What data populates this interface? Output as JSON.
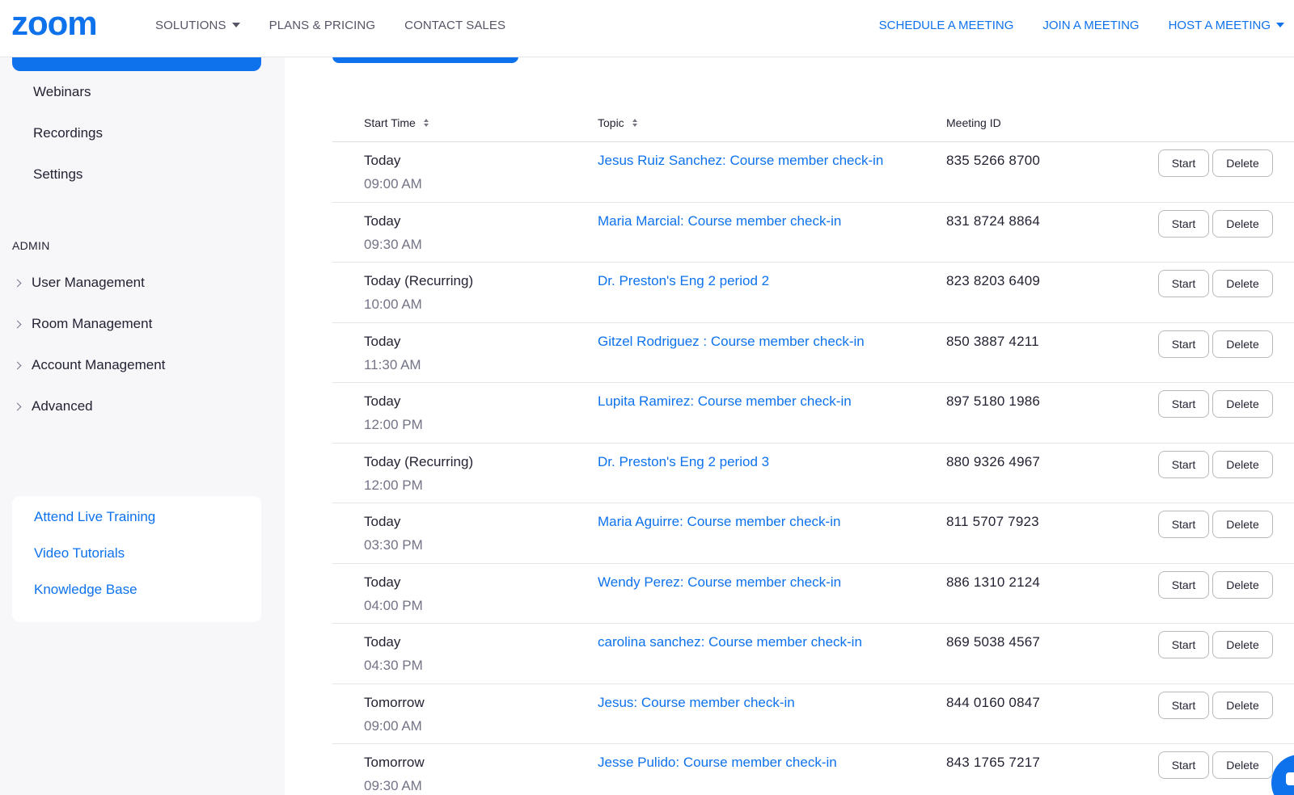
{
  "brand": {
    "logo_text": "zoom",
    "color": "#0e72ed"
  },
  "topnav": {
    "left": [
      {
        "label": "SOLUTIONS",
        "has_caret": true
      },
      {
        "label": "PLANS & PRICING",
        "has_caret": false
      },
      {
        "label": "CONTACT SALES",
        "has_caret": false
      }
    ],
    "right": [
      {
        "label": "SCHEDULE A MEETING",
        "has_caret": false
      },
      {
        "label": "JOIN A MEETING",
        "has_caret": false
      },
      {
        "label": "HOST A MEETING",
        "has_caret": true
      }
    ]
  },
  "sidebar": {
    "items": [
      {
        "label": "Webinars"
      },
      {
        "label": "Recordings"
      },
      {
        "label": "Settings"
      }
    ],
    "admin_label": "ADMIN",
    "admin_items": [
      {
        "label": "User Management"
      },
      {
        "label": "Room Management"
      },
      {
        "label": "Account Management"
      },
      {
        "label": "Advanced"
      }
    ],
    "help_links": [
      {
        "label": "Attend Live Training"
      },
      {
        "label": "Video Tutorials"
      },
      {
        "label": "Knowledge Base"
      }
    ]
  },
  "table": {
    "columns": {
      "start_time": "Start Time",
      "topic": "Topic",
      "meeting_id": "Meeting ID"
    },
    "start_label": "Start",
    "delete_label": "Delete",
    "rows": [
      {
        "date": "Today",
        "time": "09:00 AM",
        "topic": "Jesus Ruiz Sanchez: Course member check-in",
        "meeting_id": "835 5266 8700"
      },
      {
        "date": "Today",
        "time": "09:30 AM",
        "topic": "Maria Marcial: Course member check-in",
        "meeting_id": "831 8724 8864"
      },
      {
        "date": "Today (Recurring)",
        "time": "10:00 AM",
        "topic": "Dr. Preston's Eng 2 period 2",
        "meeting_id": "823 8203 6409"
      },
      {
        "date": "Today",
        "time": "11:30 AM",
        "topic": "Gitzel Rodriguez : Course member check-in",
        "meeting_id": "850 3887 4211"
      },
      {
        "date": "Today",
        "time": "12:00 PM",
        "topic": "Lupita Ramirez: Course member check-in",
        "meeting_id": "897 5180 1986"
      },
      {
        "date": "Today (Recurring)",
        "time": "12:00 PM",
        "topic": "Dr. Preston's Eng 2 period 3",
        "meeting_id": "880 9326 4967"
      },
      {
        "date": "Today",
        "time": "03:30 PM",
        "topic": "Maria Aguirre: Course member check-in",
        "meeting_id": "811 5707 7923"
      },
      {
        "date": "Today",
        "time": "04:00 PM",
        "topic": "Wendy Perez: Course member check-in",
        "meeting_id": "886 1310 2124"
      },
      {
        "date": "Today",
        "time": "04:30 PM",
        "topic": "carolina sanchez: Course member check-in",
        "meeting_id": "869 5038 4567"
      },
      {
        "date": "Tomorrow",
        "time": "09:00 AM",
        "topic": "Jesus: Course member check-in",
        "meeting_id": "844 0160 0847"
      },
      {
        "date": "Tomorrow",
        "time": "09:30 AM",
        "topic": "Jesse Pulido: Course member check-in",
        "meeting_id": "843 1765 7217"
      }
    ]
  },
  "icons": {
    "sort": "sort-icon",
    "caret": "chevron-down-icon",
    "expand": "chevron-right-icon",
    "chat": "chat-icon"
  }
}
